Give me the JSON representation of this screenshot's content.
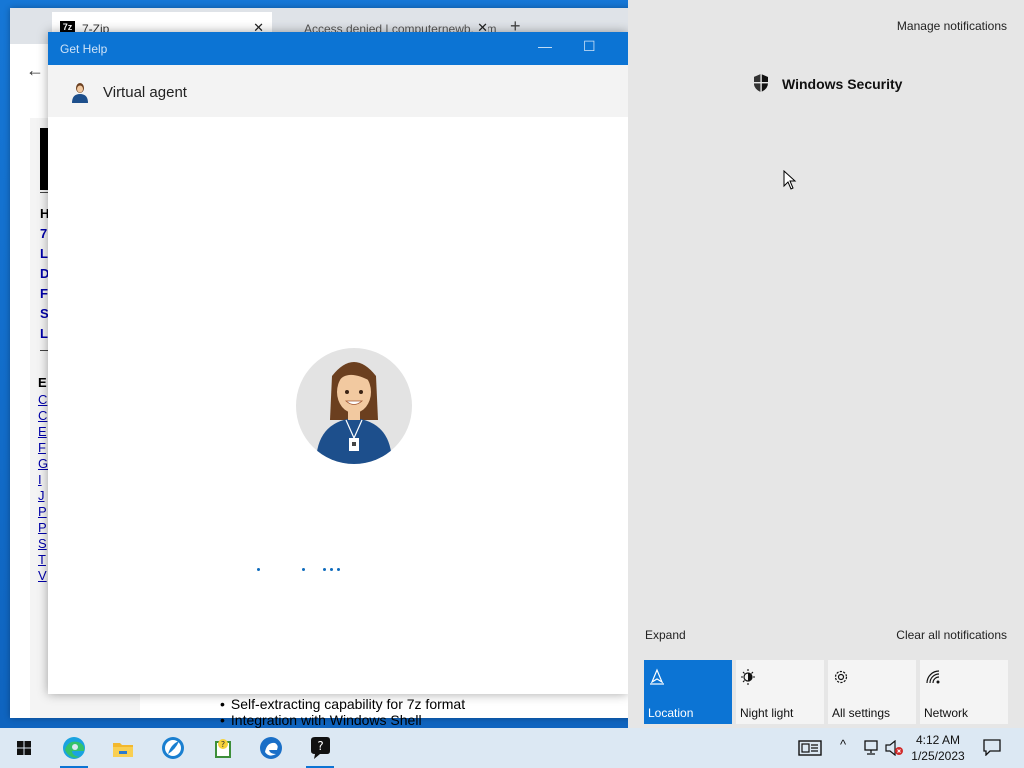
{
  "browser": {
    "tabs": [
      {
        "label": "7-Zip",
        "favicon": "7z"
      },
      {
        "label": "Access denied | computernewb.com"
      }
    ],
    "sidebar_top": [
      "H",
      "7",
      "L",
      "D",
      "F",
      "S",
      "L"
    ],
    "sidebar_bottom": [
      "E",
      "C",
      "C",
      "E",
      "F",
      "G",
      "I",
      "J",
      "P",
      "P",
      "S",
      "T",
      "V"
    ],
    "content_bullets": [
      "Self-extracting capability for 7z format",
      "Integration with Windows Shell"
    ]
  },
  "gethelp": {
    "title": "Get Help",
    "agent_name": "Virtual agent"
  },
  "action_center": {
    "manage": "Manage notifications",
    "notification_source": "Windows Security",
    "expand": "Expand",
    "clear_all": "Clear all notifications",
    "quick_actions": [
      {
        "label": "Location",
        "icon": "location-icon",
        "active": true
      },
      {
        "label": "Night light",
        "icon": "night-light-icon",
        "active": false
      },
      {
        "label": "All settings",
        "icon": "gear-icon",
        "active": false
      },
      {
        "label": "Network",
        "icon": "network-icon",
        "active": false
      }
    ]
  },
  "taskbar": {
    "time": "4:12 AM",
    "date": "1/25/2023"
  },
  "colors": {
    "accent": "#0c74d4",
    "action_center_bg": "#e6e6e6",
    "taskbar_bg": "#dce8f3"
  }
}
